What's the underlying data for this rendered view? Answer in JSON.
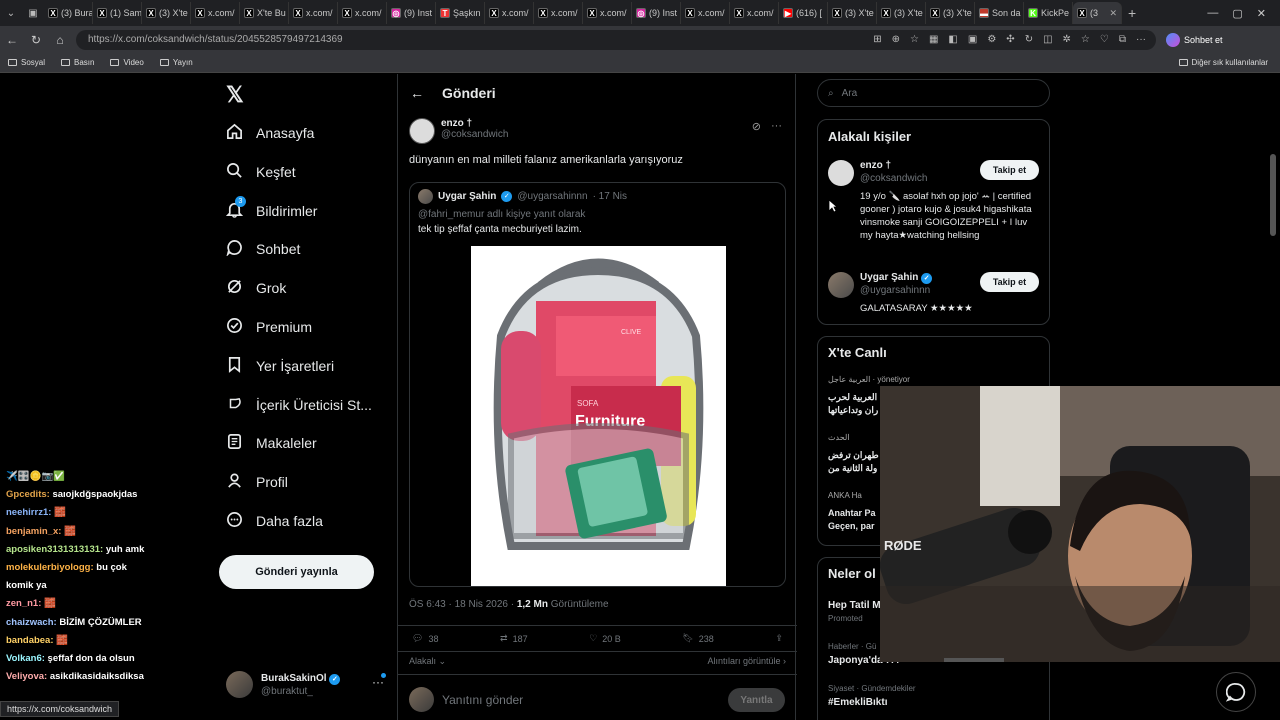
{
  "browser": {
    "tabs": [
      {
        "label": "(3) Bura",
        "icon": "x-icon"
      },
      {
        "label": "(1) Sam",
        "icon": "x-icon"
      },
      {
        "label": "(3) X'te",
        "icon": "x-icon"
      },
      {
        "label": "x.com/",
        "icon": "x-icon"
      },
      {
        "label": "X'te Bu",
        "icon": "x-icon"
      },
      {
        "label": "x.com/",
        "icon": "x-icon"
      },
      {
        "label": "x.com/",
        "icon": "x-icon"
      },
      {
        "label": "(9) Inst",
        "icon": "instagram-icon"
      },
      {
        "label": "Şaşkın",
        "icon": "t-icon"
      },
      {
        "label": "x.com/",
        "icon": "x-icon"
      },
      {
        "label": "x.com/",
        "icon": "x-icon"
      },
      {
        "label": "x.com/",
        "icon": "x-icon"
      },
      {
        "label": "(9) Inst",
        "icon": "instagram-icon"
      },
      {
        "label": "x.com/",
        "icon": "x-icon"
      },
      {
        "label": "x.com/",
        "icon": "x-icon"
      },
      {
        "label": "(616) [",
        "icon": "youtube-icon"
      },
      {
        "label": "(3) X'te",
        "icon": "x-icon"
      },
      {
        "label": "(3) X'te",
        "icon": "x-icon"
      },
      {
        "label": "(3) X'te",
        "icon": "x-icon"
      },
      {
        "label": "Son da",
        "icon": "news-icon"
      },
      {
        "label": "KickPe",
        "icon": "kick-icon"
      },
      {
        "label": "(3",
        "icon": "x-icon",
        "active": true
      }
    ],
    "url": "https://x.com/coksandwich/status/2045528579497214369",
    "chat_button": "Sohbet et",
    "bookmarks": [
      "Sosyal",
      "Basın",
      "Video",
      "Yayın"
    ],
    "bookmarks_other": "Diğer sık kullanılanlar",
    "status_url": "https://x.com/coksandwich"
  },
  "nav": {
    "items": [
      {
        "label": "Anasayfa",
        "icon": "home-icon"
      },
      {
        "label": "Keşfet",
        "icon": "search-icon"
      },
      {
        "label": "Bildirimler",
        "icon": "bell-icon",
        "badge": "3"
      },
      {
        "label": "Sohbet",
        "icon": "chat-icon"
      },
      {
        "label": "Grok",
        "icon": "grok-icon"
      },
      {
        "label": "Premium",
        "icon": "premium-icon"
      },
      {
        "label": "Yer İşaretleri",
        "icon": "bookmark-icon"
      },
      {
        "label": "İçerik Üreticisi St...",
        "icon": "rocket-icon"
      },
      {
        "label": "Makaleler",
        "icon": "article-icon"
      },
      {
        "label": "Profil",
        "icon": "person-icon"
      },
      {
        "label": "Daha fazla",
        "icon": "more-circle-icon"
      }
    ],
    "post_button": "Gönderi yayınla",
    "account": {
      "name": "BurakSakinOl",
      "handle": "@buraktut_"
    }
  },
  "post": {
    "header_title": "Gönderi",
    "author_name": "enzo †",
    "author_handle": "@coksandwich",
    "text": "dünyanın en mal milleti falanız amerikanlarla yarışıyoruz",
    "quote": {
      "author_name": "Uygar Şahin",
      "author_handle": "@uygarsahinnn",
      "date": "· 17 Nis",
      "reply_to": "@fahri_memur adlı kişiye yanıt olarak",
      "text": "tek tip şeffaf çanta mecburiyeti lazim.",
      "image_text_1": "Furniture",
      "image_text_2": "SOFA",
      "image_text_3": "CLIVE"
    },
    "time": "ÖS 6:43 · 18 Nis 2026 ·",
    "views": "1,2 Mn",
    "views_label": "Görüntüleme",
    "stats": {
      "replies": "38",
      "reposts": "187",
      "likes": "20 B",
      "bookmarks": "238"
    },
    "sort_label": "Alakalı",
    "quotes_link": "Alıntıları görüntüle",
    "reply_placeholder": "Yanıtını gönder",
    "reply_button": "Yanıtla"
  },
  "sidebar": {
    "search_placeholder": "Ara",
    "people_title": "Alakalı kişiler",
    "people": [
      {
        "name": "enzo †",
        "handle": "@coksandwich",
        "bio": "19 y/o 🔪 asolaf hxh op jojo' ꕀ | certified gooner ) jotaro kujo & josuk4 higashikata vinsmoke sanji GOIGOIZEPPELI + I luv my hayta★watching hellsing",
        "follow": "Takip et"
      },
      {
        "name": "Uygar Şahin",
        "handle": "@uygarsahinnn",
        "bio": "GALATASARAY ★★★★★",
        "follow": "Takip et"
      }
    ],
    "live_title": "X'te Canlı",
    "live": [
      {
        "source": "العربية عاجل",
        "meta": "yönetiyor",
        "line1": "العربية لحرب",
        "line2": "ران وتداعياتها"
      },
      {
        "source": "الحدث",
        "line1": "طهران ترفض",
        "line2": "ولة الثانية من"
      },
      {
        "source": "ANKA Ha",
        "line1": "Anahtar Pa",
        "line2": "Geçen, par"
      }
    ],
    "trends_title": "Neler ol",
    "trends": [
      {
        "category": "",
        "name": "Hep Tatil M",
        "meta": "Promoted"
      },
      {
        "category": "Haberler · Gü",
        "name": "Japonya'da 7.4"
      },
      {
        "category": "Siyaset · Gündemdekiler",
        "name": "#EmekliBıktı"
      }
    ]
  },
  "chat": [
    {
      "user": "",
      "msg": "✈️🎛️🪙📷✅"
    },
    {
      "user": "Gpcedits:",
      "msg": "saıojkdğspaokjdas"
    },
    {
      "user": "neehirrz1:",
      "msg": "🧱"
    },
    {
      "user": "benjamin_x:",
      "msg": "🧱"
    },
    {
      "user": "aposiken3131313131:",
      "msg": "yuh amk"
    },
    {
      "user": "molekulerbiyologg:",
      "msg": "bu çok"
    },
    {
      "user": "",
      "msg": "komik ya"
    },
    {
      "user": "zen_n1:",
      "msg": "🧱"
    },
    {
      "user": "chaizwach:",
      "msg": "BİZİM ÇÖZÜMLER"
    },
    {
      "user": "bandabea:",
      "msg": "🧱"
    },
    {
      "user": "Volkan6:",
      "msg": "şeffaf don da olsun"
    },
    {
      "user": "Veliyova:",
      "msg": "asikdikasidaiksdiksa"
    }
  ],
  "webcam": {
    "mic_brand": "RØDE"
  }
}
